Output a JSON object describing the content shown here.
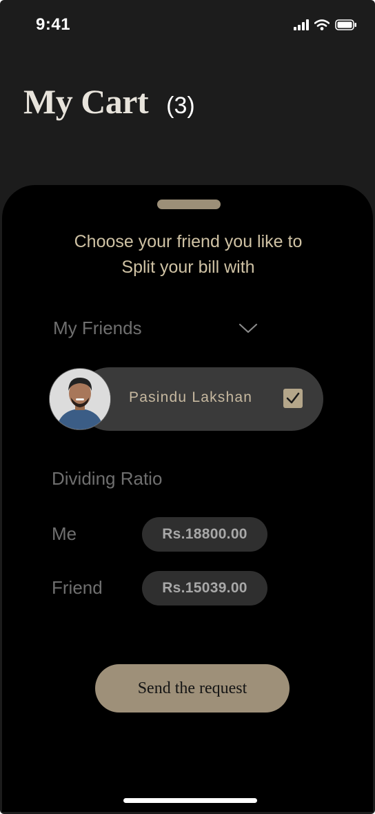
{
  "status_bar": {
    "time": "9:41"
  },
  "header": {
    "title": "My Cart",
    "count": "(3)"
  },
  "sheet": {
    "heading_line1": "Choose your friend you like to",
    "heading_line2": "Split your bill with",
    "friends_dropdown": {
      "label": "My Friends"
    },
    "selected_friend": {
      "name": "Pasindu Lakshan",
      "checked": true
    },
    "dividing_ratio": {
      "label": "Dividing Ratio",
      "rows": [
        {
          "label": "Me",
          "amount": "Rs.18800.00"
        },
        {
          "label": "Friend",
          "amount": "Rs.15039.00"
        }
      ]
    },
    "send_button": {
      "label": "Send the request"
    }
  },
  "colors": {
    "accent": "#9e9079",
    "heading_text": "#cfc2a4",
    "sheet_background": "#000000",
    "screen_background": "#1c1c1c"
  },
  "icons": [
    "signal-icon",
    "wifi-icon",
    "battery-icon",
    "chevron-down-icon",
    "check-icon"
  ]
}
